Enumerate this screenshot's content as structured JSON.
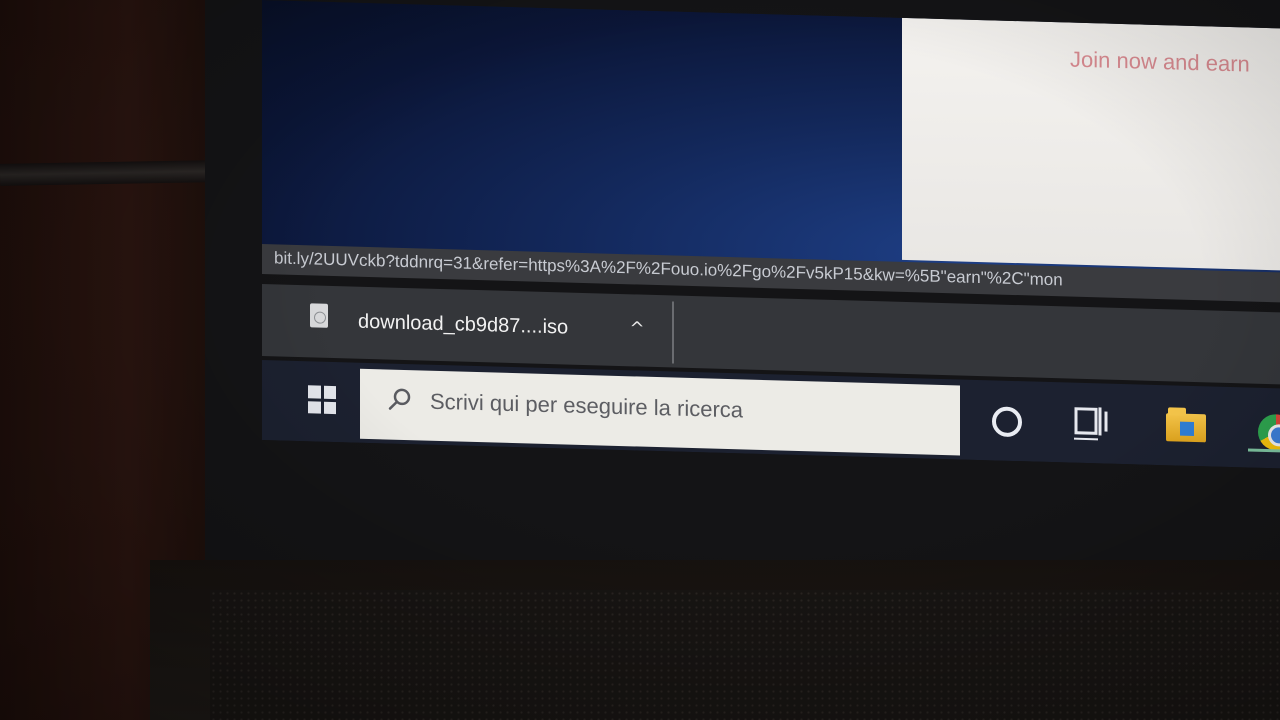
{
  "browser": {
    "page_text": "Join now and earn",
    "status_url": "bit.ly/2UUVckb?tddnrq=31&refer=https%3A%2F%2Fouo.io%2Fgo%2Fv5kP15&kw=%5B\"earn\"%2C\"mon"
  },
  "download_bar": {
    "file_name": "download_cb9d87....iso",
    "file_icon": "file-icon",
    "caret_icon": "chevron-up-icon",
    "caret_glyph": "^"
  },
  "taskbar": {
    "start_icon": "windows-logo-icon",
    "search_placeholder": "Scrivi qui per eseguire la ricerca",
    "search_icon": "search-icon",
    "icons": [
      "cortana-icon",
      "task-view-icon",
      "file-explorer-icon",
      "chrome-icon"
    ]
  },
  "colors": {
    "desktop_blue": "#13285b",
    "taskbar": "#1c2130",
    "download_bar": "#34363a",
    "link_pink": "#d88a90"
  }
}
